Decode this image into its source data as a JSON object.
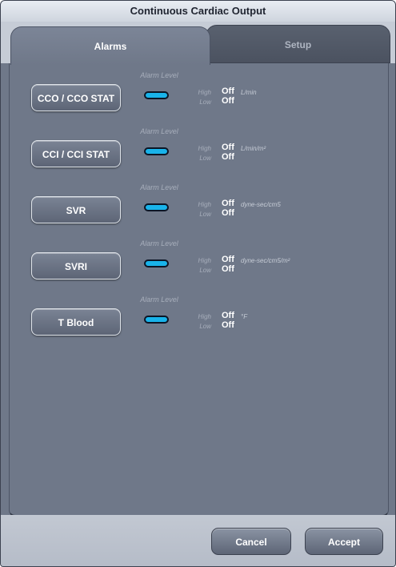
{
  "window": {
    "title": "Continuous Cardiac Output"
  },
  "tabs": [
    {
      "label": "Alarms",
      "active": true
    },
    {
      "label": "Setup",
      "active": false
    }
  ],
  "alarms": {
    "alarm_level_label": "Alarm Level",
    "high_label": "High",
    "low_label": "Low",
    "indicator_color": "#19b3ea",
    "rows": [
      {
        "name": "CCO / CCO STAT",
        "high": "Off",
        "low": "Off",
        "unit": "L/min"
      },
      {
        "name": "CCI / CCI STAT",
        "high": "Off",
        "low": "Off",
        "unit": "L/min/m²"
      },
      {
        "name": "SVR",
        "high": "Off",
        "low": "Off",
        "unit": "dyne-sec/cm5"
      },
      {
        "name": "SVRI",
        "high": "Off",
        "low": "Off",
        "unit": "dyne-sec/cm5/m²"
      },
      {
        "name": "T Blood",
        "high": "Off",
        "low": "Off",
        "unit": "°F"
      }
    ]
  },
  "footer": {
    "cancel_label": "Cancel",
    "accept_label": "Accept"
  }
}
